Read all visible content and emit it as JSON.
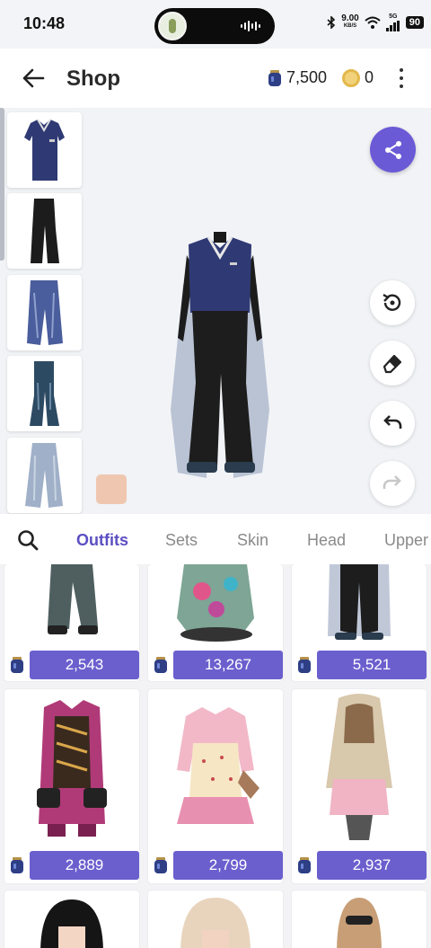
{
  "status_bar": {
    "time": "10:48",
    "net_speed": "9.00",
    "net_unit": "KB/S",
    "signal_label": "5G",
    "battery": "90"
  },
  "app_bar": {
    "title": "Shop",
    "gems": "7,500",
    "coins": "0"
  },
  "preview": {
    "thumbnails": [
      "polo-shirt-thumbnail",
      "black-flare-pants-thumbnail",
      "baggy-jeans-thumbnail",
      "flare-jeans-thumbnail",
      "wide-light-jeans-thumbnail"
    ],
    "skin_color": "#efc7b0",
    "accent_color": "#6a5ad6"
  },
  "tabs": [
    "Outfits",
    "Sets",
    "Skin",
    "Head",
    "Upper"
  ],
  "active_tab": "Outfits",
  "grid": {
    "items": [
      {
        "price": "2,543"
      },
      {
        "price": "13,267"
      },
      {
        "price": "5,521"
      },
      {
        "price": "2,889"
      },
      {
        "price": "2,799"
      },
      {
        "price": "2,937"
      }
    ]
  }
}
